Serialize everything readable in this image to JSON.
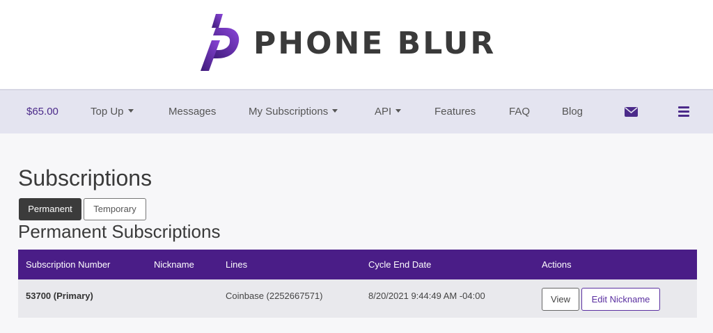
{
  "brand": {
    "name": "PHONE BLUR",
    "accent": "#4a1d87",
    "accent_light": "#7b3fd0"
  },
  "nav": {
    "balance": "$65.00",
    "items": [
      {
        "label": "Top Up",
        "dropdown": true
      },
      {
        "label": "Messages",
        "dropdown": false
      },
      {
        "label": "My Subscriptions",
        "dropdown": true
      },
      {
        "label": "API",
        "dropdown": true
      },
      {
        "label": "Features",
        "dropdown": false
      },
      {
        "label": "FAQ",
        "dropdown": false
      },
      {
        "label": "Blog",
        "dropdown": false
      }
    ],
    "icons": [
      "envelope-icon",
      "hamburger-menu-icon"
    ]
  },
  "page": {
    "title": "Subscriptions",
    "toggle": {
      "permanent": "Permanent",
      "temporary": "Temporary",
      "active": "Permanent"
    },
    "section_title": "Permanent Subscriptions"
  },
  "table": {
    "headers": [
      "Subscription Number",
      "Nickname",
      "Lines",
      "Cycle End Date",
      "Actions"
    ],
    "rows": [
      {
        "subscription_number": "53700 (Primary)",
        "nickname": "",
        "lines": "Coinbase (2252667571)",
        "cycle_end_date": "8/20/2021 9:44:49 AM -04:00",
        "actions": {
          "view": "View",
          "edit": "Edit Nickname"
        }
      }
    ]
  }
}
